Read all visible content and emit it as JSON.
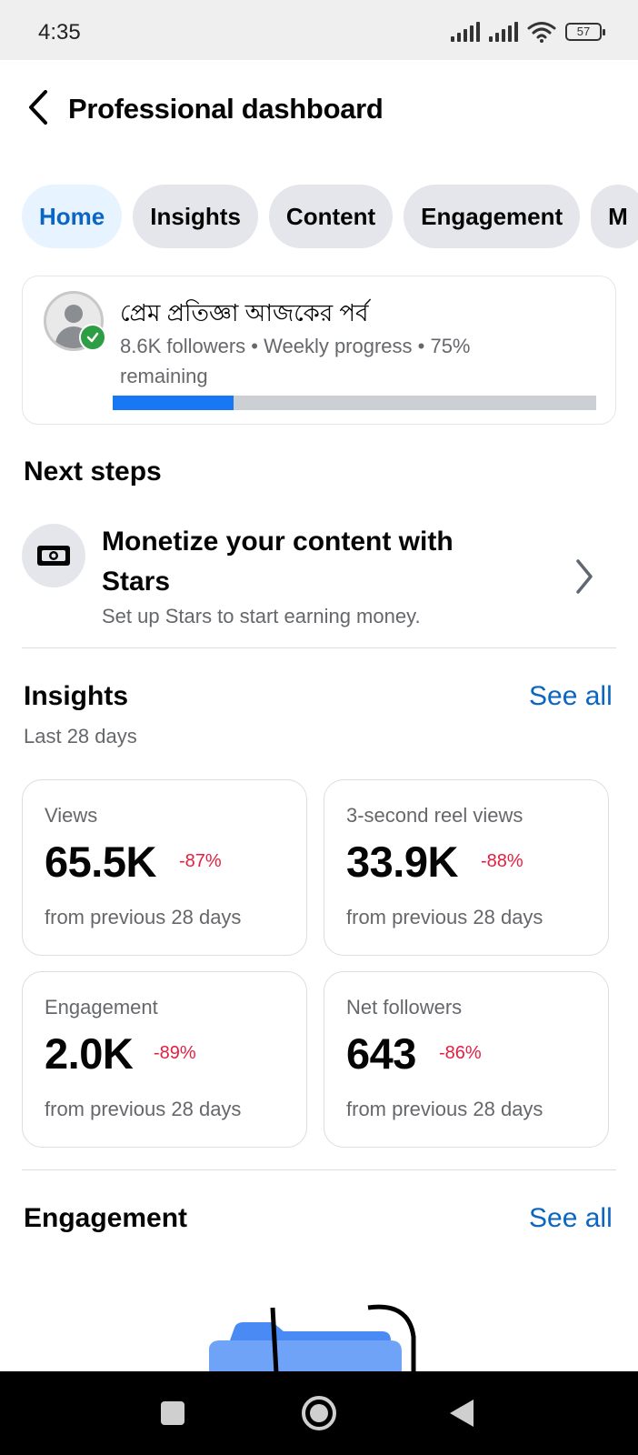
{
  "status_bar": {
    "time": "4:35",
    "battery": "57"
  },
  "header": {
    "title": "Professional dashboard"
  },
  "tabs": [
    {
      "label": "Home",
      "active": true
    },
    {
      "label": "Insights"
    },
    {
      "label": "Content"
    },
    {
      "label": "Engagement"
    },
    {
      "label": "M"
    }
  ],
  "profile": {
    "name": "প্রেম প্রতিজ্ঞা  আজকের পর্ব",
    "meta": "8.6K followers • Weekly progress • 75% remaining",
    "progress_fraction": 0.25
  },
  "next_steps": {
    "title": "Next steps",
    "item": {
      "title": "Monetize your content with Stars",
      "subtitle": "Set up Stars to start earning money."
    }
  },
  "insights": {
    "title": "Insights",
    "see_all": "See all",
    "period": "Last 28 days",
    "stats": [
      {
        "label": "Views",
        "value": "65.5K",
        "delta": "-87%",
        "foot": "from previous 28 days"
      },
      {
        "label": "3-second reel views",
        "value": "33.9K",
        "delta": "-88%",
        "foot": "from previous 28 days"
      },
      {
        "label": "Engagement",
        "value": "2.0K",
        "delta": "-89%",
        "foot": "from previous 28 days"
      },
      {
        "label": "Net followers",
        "value": "643",
        "delta": "-86%",
        "foot": "from previous 28 days"
      }
    ]
  },
  "engagement": {
    "title": "Engagement",
    "see_all": "See all"
  },
  "colors": {
    "accent": "#0a66c2",
    "negative": "#e41e3f",
    "progress": "#1877f2",
    "verified": "#2e9e44"
  }
}
